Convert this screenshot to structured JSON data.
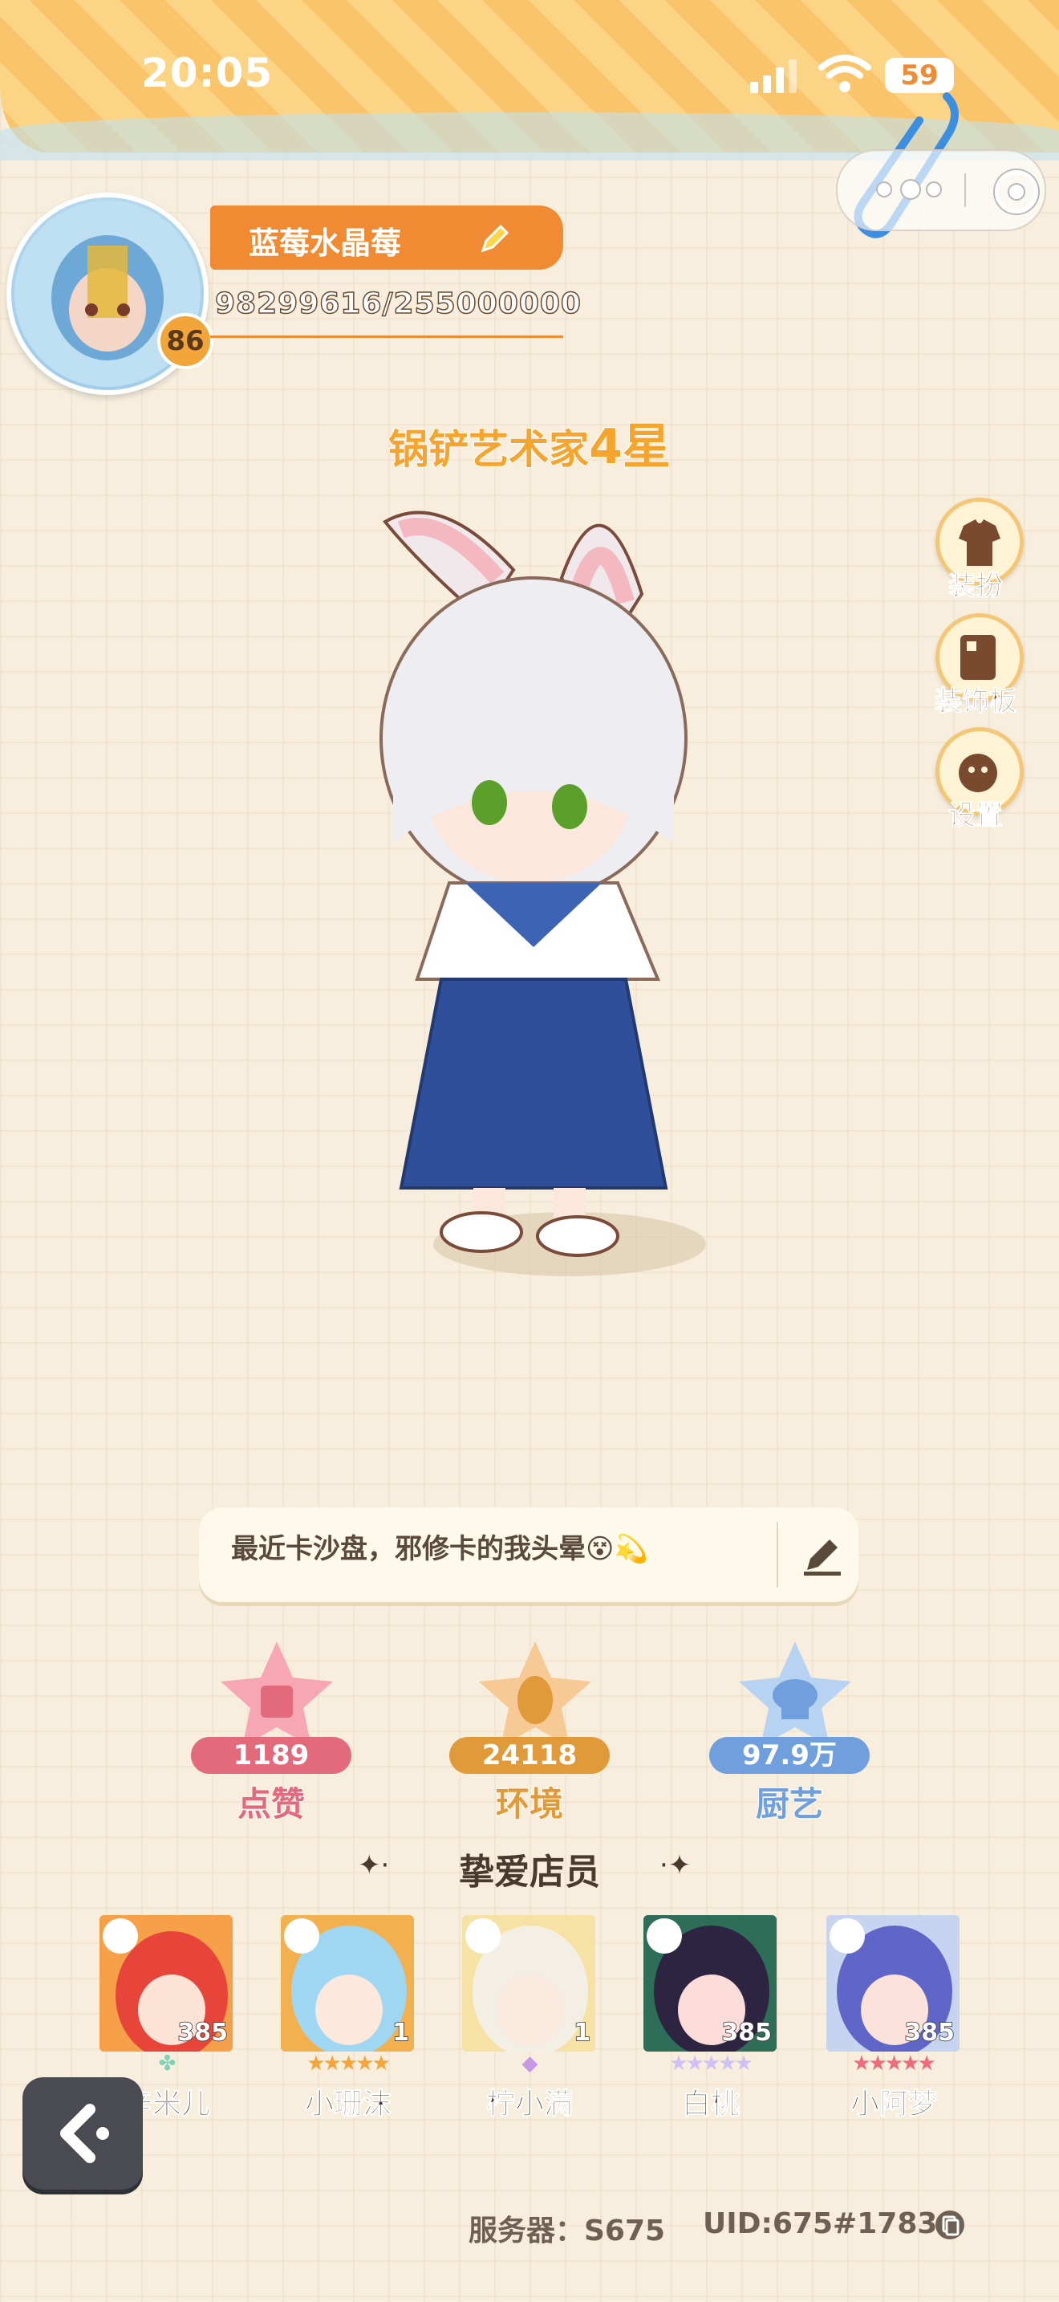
{
  "status_bar": {
    "time": "20:05",
    "battery": "59"
  },
  "profile": {
    "name": "蓝莓水晶莓",
    "level": "86",
    "exp": "98299616/255000000",
    "title_main": "锅铲艺术家",
    "title_star": "4星"
  },
  "side_menu": [
    {
      "label": "装扮",
      "icon": "outfit-icon"
    },
    {
      "label": "装饰板",
      "icon": "decor-board-icon"
    },
    {
      "label": "设置",
      "icon": "settings-icon"
    }
  ],
  "message": {
    "text": "最近卡沙盘，邪修卡的我头晕😵💫"
  },
  "stats": [
    {
      "value": "1189",
      "label": "点赞",
      "icon": "thumbs-up-icon",
      "color": "#e26a7a"
    },
    {
      "value": "24118",
      "label": "环境",
      "icon": "leaf-icon",
      "color": "#e09a3a"
    },
    {
      "value": "97.9万",
      "label": "厨艺",
      "icon": "chef-hat-icon",
      "color": "#6fa0dd"
    }
  ],
  "staff": {
    "title": "挚爱店员",
    "members": [
      {
        "name": "辛米儿",
        "count": "385",
        "color": "#f25c4a",
        "stars": 0
      },
      {
        "name": "小珊沫",
        "count": "1",
        "color": "#6cc4ee",
        "stars": 5
      },
      {
        "name": "柠小满",
        "count": "1",
        "color": "#f2d98a",
        "stars": 0
      },
      {
        "name": "白桃",
        "count": "385",
        "color": "#5b3b6b",
        "stars": 5
      },
      {
        "name": "小阿梦",
        "count": "385",
        "color": "#6c7fd6",
        "stars": 5
      }
    ]
  },
  "footer": {
    "server": "服务器：S675",
    "uid": "UID:675#17839"
  }
}
